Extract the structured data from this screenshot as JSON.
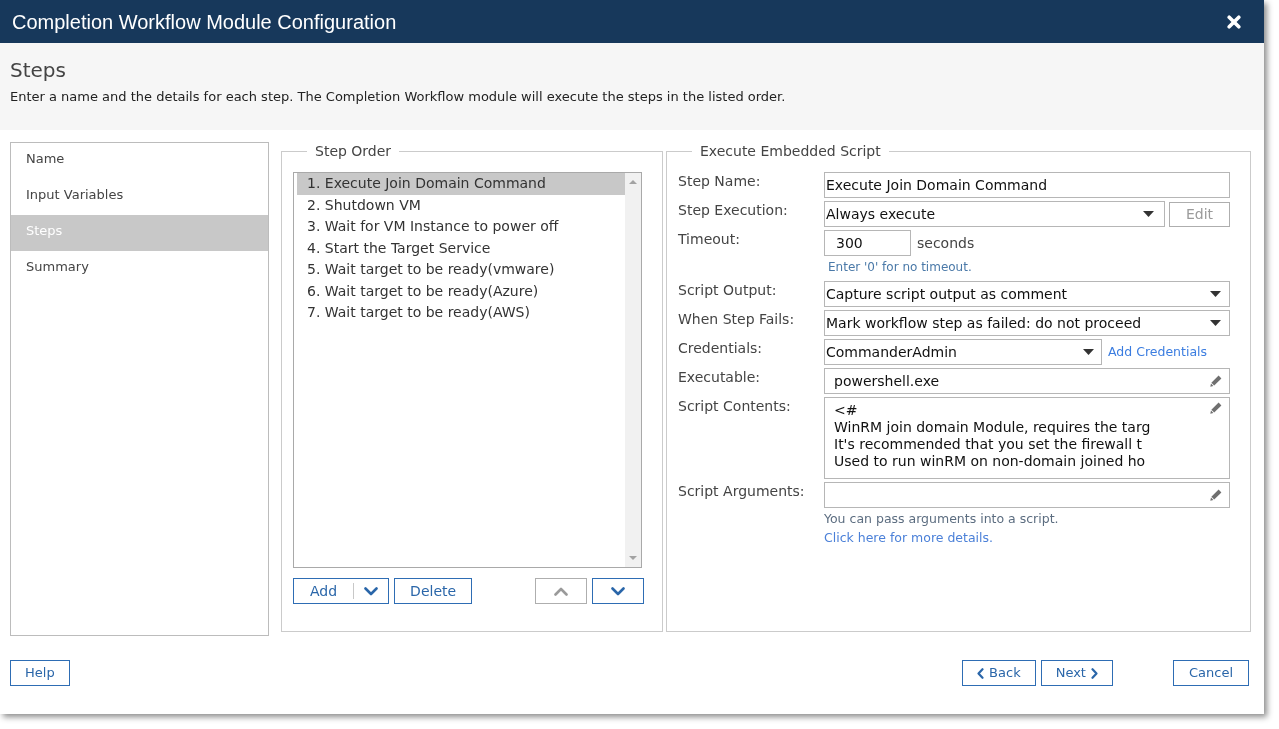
{
  "window": {
    "title": "Completion Workflow Module Configuration"
  },
  "header": {
    "title": "Steps",
    "description": "Enter a name and the details for each step. The Completion Workflow module will execute the steps in the listed order."
  },
  "sidebar": {
    "items": [
      {
        "label": "Name",
        "selected": false
      },
      {
        "label": "Input Variables",
        "selected": false
      },
      {
        "label": "Steps",
        "selected": true
      },
      {
        "label": "Summary",
        "selected": false
      }
    ]
  },
  "step_order": {
    "legend": "Step Order",
    "steps": [
      {
        "label": "1. Execute Join Domain Command",
        "selected": true
      },
      {
        "label": "2. Shutdown VM",
        "selected": false
      },
      {
        "label": "3. Wait for VM Instance to power off",
        "selected": false
      },
      {
        "label": "4. Start the Target Service",
        "selected": false
      },
      {
        "label": "5. Wait target to be ready(vmware)",
        "selected": false
      },
      {
        "label": "6. Wait target to be ready(Azure)",
        "selected": false
      },
      {
        "label": "7. Wait target to be ready(AWS)",
        "selected": false
      }
    ],
    "add_button": "Add",
    "delete_button": "Delete",
    "move_up": {
      "disabled": true
    },
    "move_down": {
      "disabled": false
    }
  },
  "step_details": {
    "legend": "Execute Embedded Script",
    "fields": [
      {
        "kind": "text",
        "label": "Step Name:",
        "value": "Execute Join Domain Command"
      },
      {
        "kind": "select",
        "label": "Step Execution:",
        "value": "Always execute",
        "button": {
          "label": "Edit",
          "disabled": true
        }
      },
      {
        "kind": "number",
        "label": "Timeout:",
        "value": "300",
        "unit": "seconds",
        "hint": "Enter '0' for no timeout."
      },
      {
        "kind": "select",
        "label": "Script Output:",
        "value": "Capture script output as comment"
      },
      {
        "kind": "select",
        "label": "When Step Fails:",
        "value": "Mark workflow step as failed: do not proceed"
      },
      {
        "kind": "select",
        "label": "Credentials:",
        "value": "CommanderAdmin",
        "link": "Add Credentials"
      },
      {
        "kind": "editable",
        "label": "Executable:",
        "value": "powershell.exe"
      },
      {
        "kind": "script",
        "label": "Script Contents:",
        "lines": [
          "<#",
          "WinRM join domain Module, requires the targ",
          "It's recommended that you set the firewall t",
          "Used to run winRM on non-domain joined ho"
        ]
      },
      {
        "kind": "editable",
        "label": "Script Arguments:",
        "hint": "You can pass arguments into a script.",
        "link": "Click here for more details."
      }
    ]
  },
  "footer": {
    "help_button": "Help",
    "nav_buttons": [
      {
        "label": "Back",
        "kind": "back"
      },
      {
        "label": "Next",
        "kind": "next"
      }
    ],
    "cancel_button": "Cancel"
  }
}
